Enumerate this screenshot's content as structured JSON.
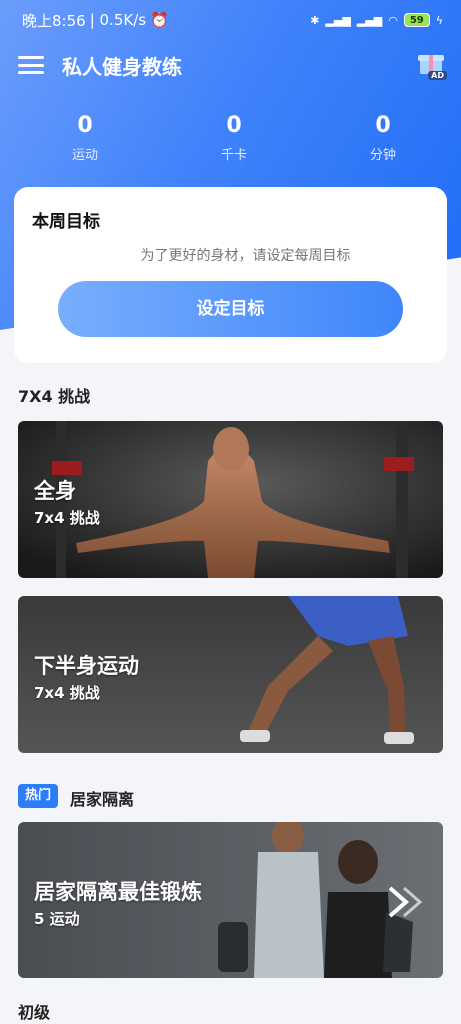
{
  "status_bar": {
    "time": "晚上8:56",
    "speed": "| 0.5K/s",
    "battery": "59"
  },
  "header": {
    "title": "私人健身教练",
    "ad_label": "AD"
  },
  "stats": [
    {
      "value": "0",
      "label": "运动"
    },
    {
      "value": "0",
      "label": "千卡"
    },
    {
      "value": "0",
      "label": "分钟"
    }
  ],
  "goal": {
    "title": "本周目标",
    "subtitle": "为了更好的身材，请设定每周目标",
    "button": "设定目标"
  },
  "challenge_section": {
    "title": "7X4 挑战",
    "cards": [
      {
        "title": "全身",
        "subtitle": "7x4 挑战"
      },
      {
        "title": "下半身运动",
        "subtitle": "7x4 挑战"
      }
    ]
  },
  "home_section": {
    "badge": "热门",
    "title": "居家隔离",
    "card": {
      "title": "居家隔离最佳锻炼",
      "subtitle": "5 运动"
    }
  },
  "beginner_section": {
    "title": "初级"
  },
  "colors": {
    "accent": "#2b7df8",
    "hero_start": "#6b9dfb",
    "hero_end": "#1f6cf5"
  }
}
